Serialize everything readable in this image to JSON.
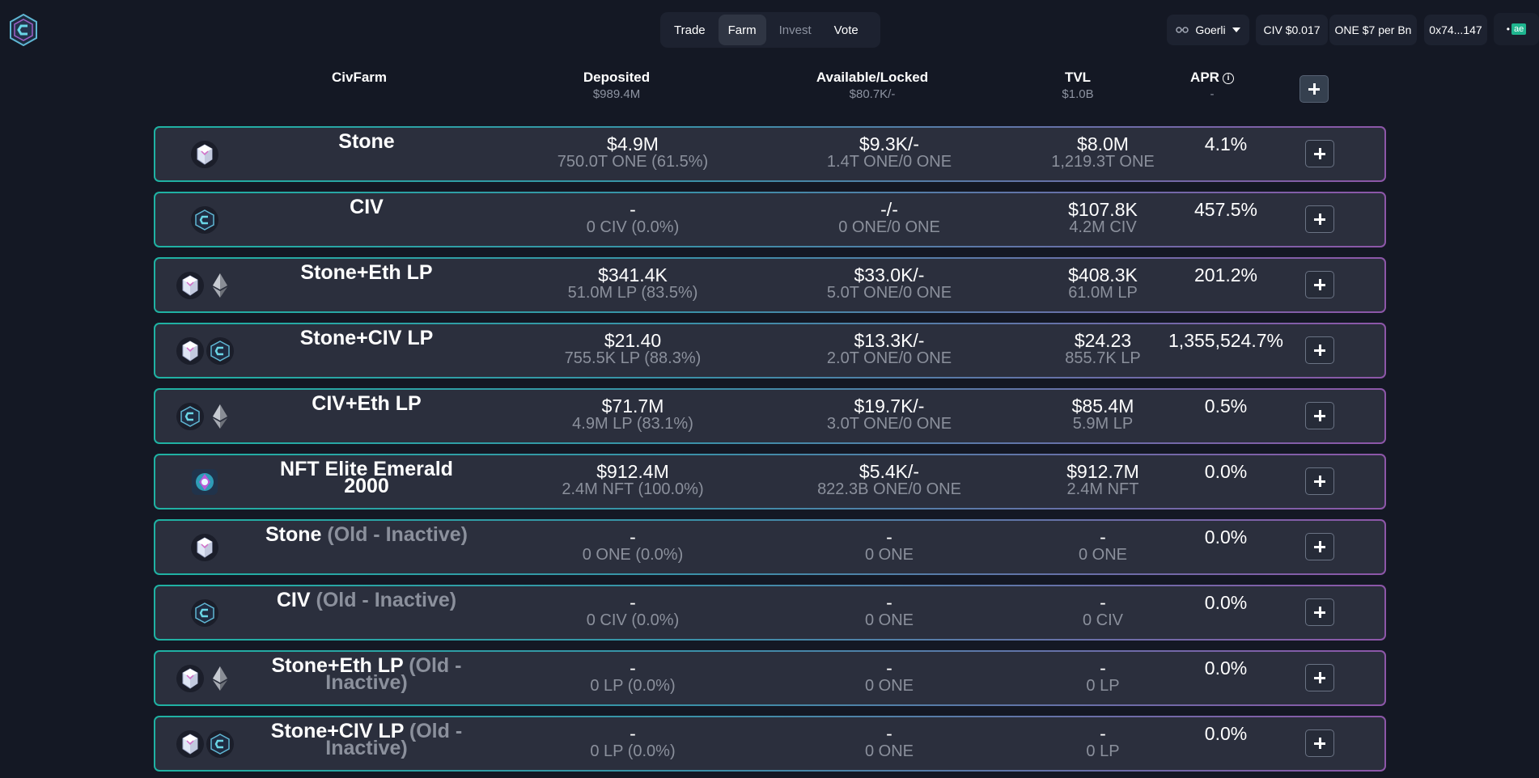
{
  "header": {
    "nav_tabs": [
      {
        "label": "Trade",
        "state": "normal"
      },
      {
        "label": "Farm",
        "state": "active"
      },
      {
        "label": "Invest",
        "state": "disabled"
      },
      {
        "label": "Vote",
        "state": "normal"
      }
    ],
    "network": "Goerli",
    "civ_price": "CIV $0.017",
    "one_price": "ONE $7 per Bn",
    "account": "0x74...147",
    "wallet_icon_label": "ae"
  },
  "columns": {
    "farm": {
      "title": "CivFarm"
    },
    "deposited": {
      "title": "Deposited",
      "sub": "$989.4M"
    },
    "available": {
      "title": "Available/Locked",
      "sub": "$80.7K/-"
    },
    "tvl": {
      "title": "TVL",
      "sub": "$1.0B"
    },
    "apr": {
      "title": "APR",
      "sub": "-"
    }
  },
  "rows": [
    {
      "name": "Stone",
      "name_suffix": "",
      "icons": [
        "stone"
      ],
      "deposited": "$4.9M",
      "deposited_sub": "750.0T ONE (61.5%)",
      "available": "$9.3K/-",
      "available_sub": "1.4T ONE/0 ONE",
      "tvl": "$8.0M",
      "tvl_sub": "1,219.3T ONE",
      "apr": "4.1%"
    },
    {
      "name": "CIV",
      "name_suffix": "",
      "icons": [
        "civ"
      ],
      "deposited": "-",
      "deposited_sub": "0 CIV (0.0%)",
      "available": "-/-",
      "available_sub": "0 ONE/0 ONE",
      "tvl": "$107.8K",
      "tvl_sub": "4.2M CIV",
      "apr": "457.5%"
    },
    {
      "name": "Stone+Eth LP",
      "name_suffix": "",
      "icons": [
        "stone",
        "eth"
      ],
      "deposited": "$341.4K",
      "deposited_sub": "51.0M LP (83.5%)",
      "available": "$33.0K/-",
      "available_sub": "5.0T ONE/0 ONE",
      "tvl": "$408.3K",
      "tvl_sub": "61.0M LP",
      "apr": "201.2%"
    },
    {
      "name": "Stone+CIV LP",
      "name_suffix": "",
      "icons": [
        "stone",
        "civ"
      ],
      "deposited": "$21.40",
      "deposited_sub": "755.5K LP (88.3%)",
      "available": "$13.3K/-",
      "available_sub": "2.0T ONE/0 ONE",
      "tvl": "$24.23",
      "tvl_sub": "855.7K LP",
      "apr": "1,355,524.7%"
    },
    {
      "name": "CIV+Eth LP",
      "name_suffix": "",
      "icons": [
        "civ",
        "eth"
      ],
      "deposited": "$71.7M",
      "deposited_sub": "4.9M LP (83.1%)",
      "available": "$19.7K/-",
      "available_sub": "3.0T ONE/0 ONE",
      "tvl": "$85.4M",
      "tvl_sub": "5.9M LP",
      "apr": "0.5%"
    },
    {
      "name": "NFT Elite Emerald 2000",
      "name_suffix": "",
      "icons": [
        "nft"
      ],
      "deposited": "$912.4M",
      "deposited_sub": "2.4M NFT (100.0%)",
      "available": "$5.4K/-",
      "available_sub": "822.3B ONE/0 ONE",
      "tvl": "$912.7M",
      "tvl_sub": "2.4M NFT",
      "apr": "0.0%"
    },
    {
      "name": "Stone",
      "name_suffix": " (Old - Inactive)",
      "icons": [
        "stone"
      ],
      "deposited": "-",
      "deposited_sub": "0 ONE (0.0%)",
      "available": "-",
      "available_sub": "0 ONE",
      "tvl": "-",
      "tvl_sub": "0 ONE",
      "apr": "0.0%"
    },
    {
      "name": "CIV",
      "name_suffix": " (Old - Inactive)",
      "icons": [
        "civ"
      ],
      "deposited": "-",
      "deposited_sub": "0 CIV (0.0%)",
      "available": "-",
      "available_sub": "0 ONE",
      "tvl": "-",
      "tvl_sub": "0 CIV",
      "apr": "0.0%"
    },
    {
      "name": "Stone+Eth LP",
      "name_suffix": " (Old - Inactive)",
      "icons": [
        "stone",
        "eth"
      ],
      "deposited": "-",
      "deposited_sub": "0 LP (0.0%)",
      "available": "-",
      "available_sub": "0 ONE",
      "tvl": "-",
      "tvl_sub": "0 LP",
      "apr": "0.0%"
    },
    {
      "name": "Stone+CIV LP",
      "name_suffix": " (Old - Inactive)",
      "icons": [
        "stone",
        "civ"
      ],
      "deposited": "-",
      "deposited_sub": "0 LP (0.0%)",
      "available": "-",
      "available_sub": "0 ONE",
      "tvl": "-",
      "tvl_sub": "0 LP",
      "apr": "0.0%"
    }
  ],
  "colors": {
    "background": "#141824",
    "row_background": "#2b2f3d",
    "row_border_start": "#1fb2a3",
    "row_border_end": "#8d56a8",
    "muted_text": "#8b909c"
  }
}
